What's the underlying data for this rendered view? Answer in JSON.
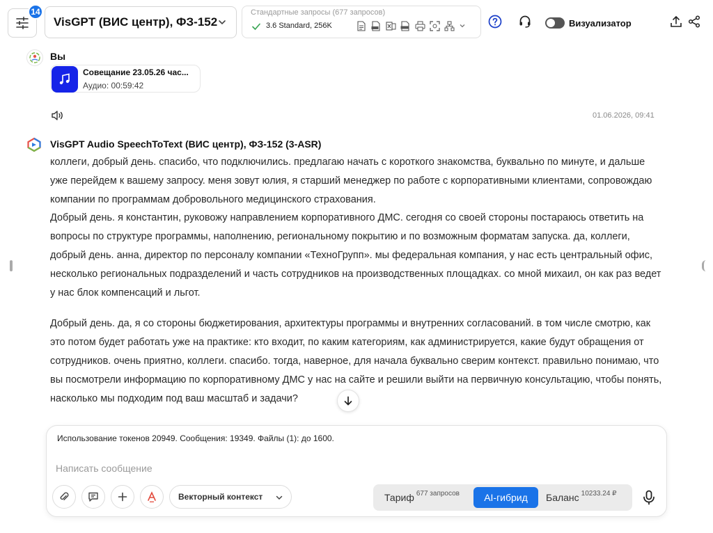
{
  "header": {
    "badge_count": "14",
    "model_label": "VisGPT (ВИС центр), ФЗ-152",
    "mode_caption": "Стандартные запросы (677 запросов)",
    "mode_value": "3.6 Standard, 256K",
    "visualizer_label": "Визуализатор",
    "file_icons": [
      "doc-icon",
      "pdf-icon",
      "excel-icon",
      "pptx-icon",
      "print-icon",
      "scan-icon",
      "diagram-icon"
    ],
    "accent_color": "#1a73e8"
  },
  "user_message": {
    "author": "Вы",
    "attachment_name": "Совещание 23.05.26 час...",
    "attachment_duration": "Аудио: 00:59:42",
    "timestamp": "01.06.2026, 09:41"
  },
  "bot_message": {
    "author": "VisGPT Audio SpeechToText (ВИС центр), ФЗ-152 (3-ASR)",
    "paragraphs": [
      "коллеги, добрый день. спасибо, что подключились. предлагаю начать с короткого знакомства, буквально по минуте, и дальше уже перейдем к вашему запросу. меня зовут юлия, я старший менеджер по работе с корпоративными клиентами, сопровождаю компании по программам добровольного медицинского страхования.",
      "Добрый день. я константин, руковожу направлением корпоративного ДМС. сегодня со своей стороны постараюсь ответить на вопросы по структуре программы, наполнению, региональному покрытию и по возможным форматам запуска. да, коллеги, добрый день. анна, директор по персоналу компании «ТехноГрупп». мы федеральная компания, у нас есть центральный офис, несколько региональных подразделений и часть сотрудников на производственных площадках. со мной михаил, он как раз ведет у нас блок компенсаций и льгот.",
      "Добрый день. да, я со стороны бюджетирования, архитектуры программы и внутренних согласований. в том числе смотрю, как это потом будет работать уже на практике: кто входит, по каким категориям, как администрируется, какие будут обращения от сотрудников. очень приятно, коллеги. спасибо. тогда, наверное, для начала буквально сверим контекст. правильно понимаю, что вы посмотрели информацию по корпоративному ДМС у нас на сайте и решили выйти на первичную консультацию, чтобы понять, насколько мы подходим под ваш масштаб и задачи?"
    ]
  },
  "composer": {
    "usage": "Использование токенов 20949. Сообщения: 19349. Файлы (1): до 1600.",
    "placeholder": "Написать сообщение",
    "context_label": "Векторный контекст",
    "tariff_label": "Тариф",
    "tariff_sup": "677 запросов",
    "hybrid_label": "AI-гибрид",
    "balance_label": "Баланс",
    "balance_sup": "10233.24 ₽"
  }
}
